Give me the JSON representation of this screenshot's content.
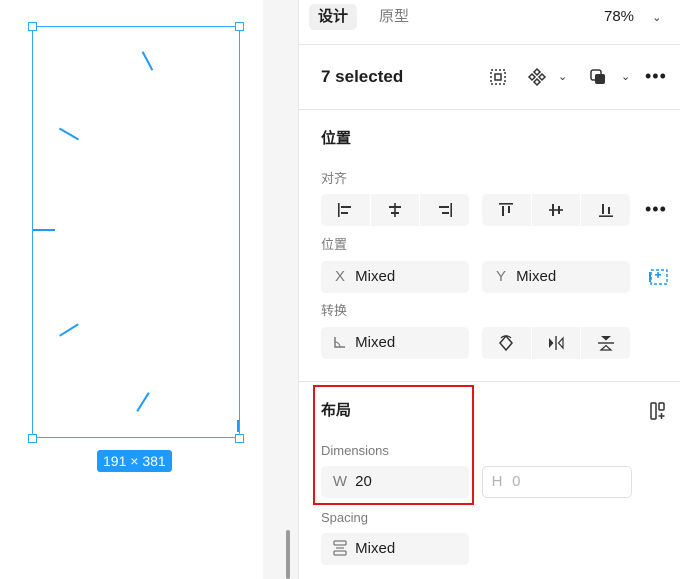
{
  "canvas": {
    "dimension_badge": "191 × 381"
  },
  "panel": {
    "tabs": [
      {
        "label": "设计",
        "active": true
      },
      {
        "label": "原型",
        "active": false
      }
    ],
    "zoom": "78%",
    "selection_title": "7 selected",
    "position_section": {
      "title": "位置",
      "align_label": "对齐",
      "position_label": "位置",
      "x_prefix": "X",
      "x_value": "Mixed",
      "y_prefix": "Y",
      "y_value": "Mixed",
      "transform_label": "转换",
      "rotation_value": "Mixed"
    },
    "layout_section": {
      "title": "布局",
      "dimensions_label": "Dimensions",
      "w_prefix": "W",
      "w_value": "20",
      "h_prefix": "H",
      "h_value": "0",
      "spacing_label": "Spacing",
      "spacing_value": "Mixed"
    }
  },
  "colors": {
    "selection": "#1f9aff",
    "highlight": "#e01515"
  }
}
